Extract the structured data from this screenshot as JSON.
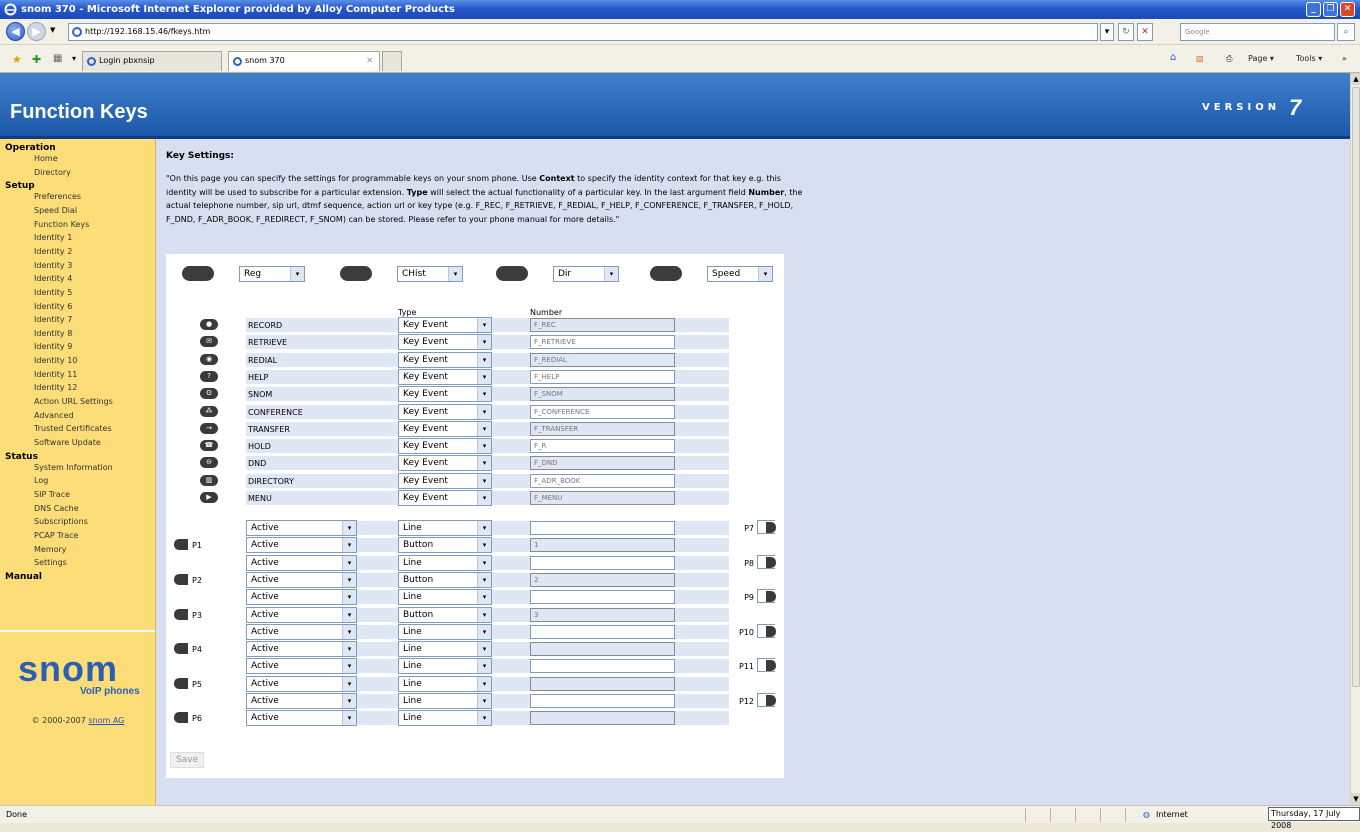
{
  "window": {
    "title": "snom 370 - Microsoft Internet Explorer provided by Alloy Computer Products"
  },
  "browser": {
    "url": "http://192.168.15.46/fkeys.htm",
    "search_placeholder": "Google",
    "tabs": [
      {
        "label": "Login pbxnsip"
      },
      {
        "label": "snom 370"
      }
    ],
    "toolbar_page": "Page ▾",
    "toolbar_tools": "Tools ▾"
  },
  "header": {
    "title": "Function Keys",
    "version_label": "VERSION",
    "version_number": "7"
  },
  "sidebar": {
    "sections": [
      {
        "heading": "Operation",
        "items": [
          "Home",
          "Directory"
        ]
      },
      {
        "heading": "Setup",
        "items": [
          "Preferences",
          "Speed Dial",
          "Function Keys",
          "Identity 1",
          "Identity 2",
          "Identity 3",
          "Identity 4",
          "Identity 5",
          "Identity 6",
          "Identity 7",
          "Identity 8",
          "Identity 9",
          "Identity 10",
          "Identity 11",
          "Identity 12",
          "Action URL Settings",
          "Advanced",
          "Trusted Certificates",
          "Software Update"
        ]
      },
      {
        "heading": "Status",
        "items": [
          "System Information",
          "Log",
          "SIP Trace",
          "DNS Cache",
          "Subscriptions",
          "PCAP Trace",
          "Memory",
          "Settings"
        ]
      },
      {
        "heading": "Manual",
        "items": []
      }
    ],
    "logo_text": "snom",
    "logo_sub": "VoIP phones",
    "copyright_prefix": "© 2000-2007 ",
    "copyright_link": "snom AG"
  },
  "content": {
    "heading": "Key Settings:",
    "intro_1": "\"On this page you can specify the settings for programmable keys on your snom phone. Use ",
    "intro_context": "Context",
    "intro_2": " to specify the identity context for that key e.g. this identity will be used to subscribe for a particular extension. ",
    "intro_type": "Type",
    "intro_3": " will select the actual functionality of a particular key. In the last argument field ",
    "intro_number": "Number",
    "intro_4": ", the actual telephone number, sip url, dtmf sequence, action url or key type (e.g. F_REC, F_RETRIEVE, F_REDIAL, F_HELP, F_CONFERENCE, F_TRANSFER, F_HOLD, F_DND, F_ADR_BOOK, F_REDIRECT, F_SNOM) can be stored. Please refer to your phone manual for more details.\"",
    "softkeys": [
      "Reg",
      "CHist",
      "Dir",
      "Speed"
    ],
    "col_type": "Type",
    "col_number": "Number",
    "fixed_keys": [
      {
        "label": "RECORD",
        "type": "Key Event",
        "number": "F_REC",
        "icon": "record-icon",
        "glyph": "●"
      },
      {
        "label": "RETRIEVE",
        "type": "Key Event",
        "number": "F_RETRIEVE",
        "icon": "retrieve-icon",
        "glyph": "✉"
      },
      {
        "label": "REDIAL",
        "type": "Key Event",
        "number": "F_REDIAL",
        "icon": "redial-icon",
        "glyph": "◉"
      },
      {
        "label": "HELP",
        "type": "Key Event",
        "number": "F_HELP",
        "icon": "help-icon",
        "glyph": "?"
      },
      {
        "label": "SNOM",
        "type": "Key Event",
        "number": "F_SNOM",
        "icon": "snom-icon",
        "glyph": "ʘ"
      },
      {
        "label": "CONFERENCE",
        "type": "Key Event",
        "number": "F_CONFERENCE",
        "icon": "conference-icon",
        "glyph": "⁂"
      },
      {
        "label": "TRANSFER",
        "type": "Key Event",
        "number": "F_TRANSFER",
        "icon": "transfer-icon",
        "glyph": "→"
      },
      {
        "label": "HOLD",
        "type": "Key Event",
        "number": "F_R",
        "icon": "hold-icon",
        "glyph": "☎"
      },
      {
        "label": "DND",
        "type": "Key Event",
        "number": "F_DND",
        "icon": "dnd-icon",
        "glyph": "⊖"
      },
      {
        "label": "DIRECTORY",
        "type": "Key Event",
        "number": "F_ADR_BOOK",
        "icon": "directory-icon",
        "glyph": "▥"
      },
      {
        "label": "MENU",
        "type": "Key Event",
        "number": "F_MENU",
        "icon": "menu-icon",
        "glyph": "▶"
      }
    ],
    "prog_rows": [
      {
        "side": "right",
        "label": "P7",
        "context": "Active",
        "type": "Line",
        "number": ""
      },
      {
        "side": "left",
        "label": "P1",
        "context": "Active",
        "type": "Button",
        "number": "1"
      },
      {
        "side": "right",
        "label": "P8",
        "context": "Active",
        "type": "Line",
        "number": ""
      },
      {
        "side": "left",
        "label": "P2",
        "context": "Active",
        "type": "Button",
        "number": "2"
      },
      {
        "side": "right",
        "label": "P9",
        "context": "Active",
        "type": "Line",
        "number": ""
      },
      {
        "side": "left",
        "label": "P3",
        "context": "Active",
        "type": "Button",
        "number": "3"
      },
      {
        "side": "right",
        "label": "P10",
        "context": "Active",
        "type": "Line",
        "number": ""
      },
      {
        "side": "left",
        "label": "P4",
        "context": "Active",
        "type": "Line",
        "number": ""
      },
      {
        "side": "right",
        "label": "P11",
        "context": "Active",
        "type": "Line",
        "number": ""
      },
      {
        "side": "left",
        "label": "P5",
        "context": "Active",
        "type": "Line",
        "number": ""
      },
      {
        "side": "right",
        "label": "P12",
        "context": "Active",
        "type": "Line",
        "number": ""
      },
      {
        "side": "left",
        "label": "P6",
        "context": "Active",
        "type": "Line",
        "number": ""
      }
    ],
    "save_label": "Save"
  },
  "statusbar": {
    "left": "Done",
    "zone": "Internet",
    "date": "Thursday, 17 July 2008"
  }
}
